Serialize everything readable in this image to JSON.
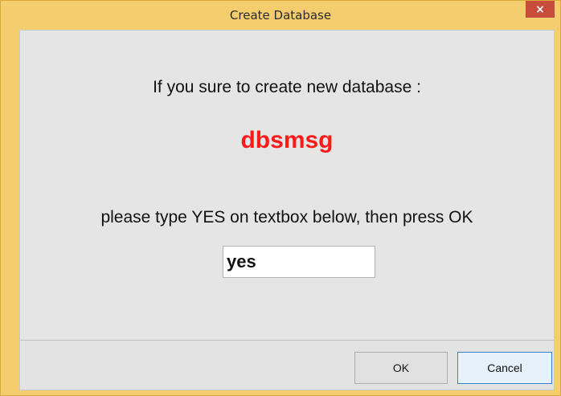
{
  "window": {
    "title": "Create Database",
    "close_label": "×"
  },
  "dialog": {
    "question": "If you sure to create new database :",
    "database_name": "dbsmsg",
    "instruction": "please type YES on textbox below, then press OK",
    "confirm_input_value": "yes"
  },
  "buttons": {
    "ok_label": "OK",
    "cancel_label": "Cancel"
  },
  "colors": {
    "title_bar": "#f4cd6e",
    "database_name": "#ff1a1a",
    "close_button": "#c74c3c"
  }
}
